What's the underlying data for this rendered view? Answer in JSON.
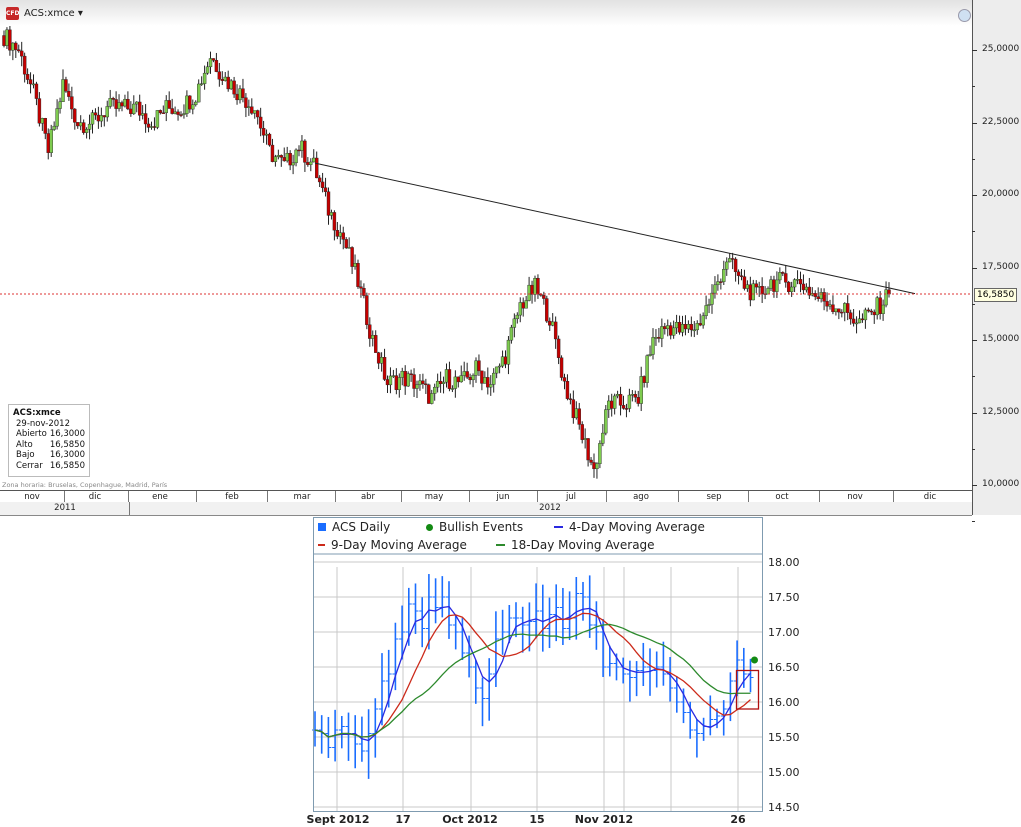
{
  "header": {
    "badge": "CFD",
    "symbol": "ACS:xmce",
    "dropdown_icon": "caret-down",
    "clock_icon": "clock"
  },
  "top_axis": {
    "ticks": [
      "25,0000",
      "22,5000",
      "20,0000",
      "17,5000",
      "15,0000",
      "12,5000",
      "10,0000"
    ],
    "current_price": "16,5850"
  },
  "info_box": {
    "title": "ACS:xmce",
    "date": "29-nov-2012",
    "rows": [
      {
        "label": "Abierto",
        "value": "16,3000"
      },
      {
        "label": "Alto",
        "value": "16,5850"
      },
      {
        "label": "Bajo",
        "value": "16,3000"
      },
      {
        "label": "Cerrar",
        "value": "16,5850"
      }
    ]
  },
  "timezone": "Zona horaria: Bruselas, Copenhague, Madrid, París",
  "months": [
    "nov",
    "dic",
    "ene",
    "feb",
    "mar",
    "abr",
    "may",
    "jun",
    "jul",
    "ago",
    "sep",
    "oct",
    "nov",
    "dic"
  ],
  "years": [
    "2011",
    "2012"
  ],
  "colors": {
    "up": "#7ecb4f",
    "down": "#c40000",
    "ma4": "#2a2ae0",
    "ma9": "#cc2a1a",
    "ma18": "#2d8a2d",
    "bars": "#1a6dff",
    "bullish": "#138a13"
  },
  "legend": {
    "daily": "ACS Daily",
    "bullish": "Bullish Events",
    "ma4": "4-Day Moving Average",
    "ma9": "9-Day Moving Average",
    "ma18": "18-Day Moving Average"
  },
  "lower_axis": {
    "ticks": [
      "18.00",
      "17.50",
      "17.00",
      "16.50",
      "16.00",
      "15.50",
      "15.00",
      "14.50"
    ],
    "xlabels": [
      "Sept 2012",
      "17",
      "Oct 2012",
      "15",
      "Nov 2012",
      "26"
    ]
  },
  "chart_data": [
    {
      "type": "candlestick",
      "title": "ACS:xmce",
      "period": "weekly closes Nov 2011 – 29 Nov 2012",
      "ylim": [
        10,
        26.5
      ],
      "closes": [
        25.5,
        25,
        23.5,
        21.5,
        23.8,
        22.5,
        22.5,
        23,
        23,
        23,
        22.5,
        23,
        23,
        23.5,
        24.8,
        24,
        23.5,
        23,
        21.5,
        21,
        21.7,
        21,
        19.5,
        18.5,
        17,
        15,
        13.5,
        13.7,
        13.5,
        13,
        13.7,
        13.5,
        14,
        13.5,
        14.5,
        16.2,
        16.8,
        15.8,
        13.5,
        12,
        10.5,
        12.8,
        12.8,
        13,
        15,
        15.5,
        15.3,
        15.5,
        16.5,
        17.8,
        17,
        16.5,
        17,
        17,
        17,
        16.5,
        16.3,
        16,
        15.6,
        16,
        16.585
      ],
      "trendline": {
        "from": 21.1,
        "to": 16.6
      },
      "current": 16.585
    },
    {
      "type": "ohlc",
      "title": "ACS Daily",
      "period": "29 Aug 2012 – 29 Nov 2012",
      "ylim": [
        14.5,
        18.1
      ],
      "closes": [
        15.6,
        15.55,
        15.35,
        15.6,
        15.65,
        15.55,
        15.4,
        15.3,
        15.55,
        15.9,
        16.3,
        16.4,
        16.9,
        17.0,
        17.4,
        17.3,
        17.05,
        17.5,
        17.35,
        17.5,
        17.1,
        17.0,
        16.7,
        16.5,
        16.2,
        16.05,
        16.4,
        16.9,
        17.0,
        17.2,
        17.2,
        17.1,
        17.15,
        17.3,
        17.05,
        17.25,
        17.35,
        17.05,
        17.2,
        17.55,
        17.5,
        17.1,
        17.0,
        16.5,
        16.55,
        16.5,
        16.4,
        16.35,
        16.45,
        16.5,
        16.45,
        16.5,
        16.4,
        16.2,
        16.0,
        15.85,
        15.6,
        15.55,
        15.65,
        15.75,
        15.8,
        15.9,
        16.3,
        16.6,
        16.4,
        16.35
      ],
      "bullish_event": 16.6,
      "moving_averages": [
        4,
        9,
        18
      ]
    }
  ]
}
